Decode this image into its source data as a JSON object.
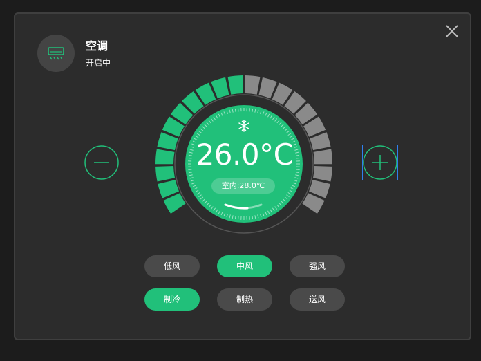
{
  "device": {
    "name": "空调",
    "status": "开启中",
    "icon": "air-conditioner-icon"
  },
  "thermostat": {
    "temperature": "26.0°C",
    "indoor": "室内:28.0℃",
    "mode_icon": "snowflake-icon",
    "level": {
      "filled_segments": 11,
      "total_segments": 22
    }
  },
  "fan_speed": [
    {
      "label": "低风",
      "active": false
    },
    {
      "label": "中风",
      "active": true
    },
    {
      "label": "强风",
      "active": false
    }
  ],
  "modes": [
    {
      "label": "制冷",
      "active": true
    },
    {
      "label": "制热",
      "active": false
    },
    {
      "label": "送风",
      "active": false
    }
  ],
  "colors": {
    "accent": "#21c07a",
    "inactive_segment": "#8a8a8a",
    "panel": "#2c2c2c",
    "chip_inactive": "#4a4a4a"
  }
}
